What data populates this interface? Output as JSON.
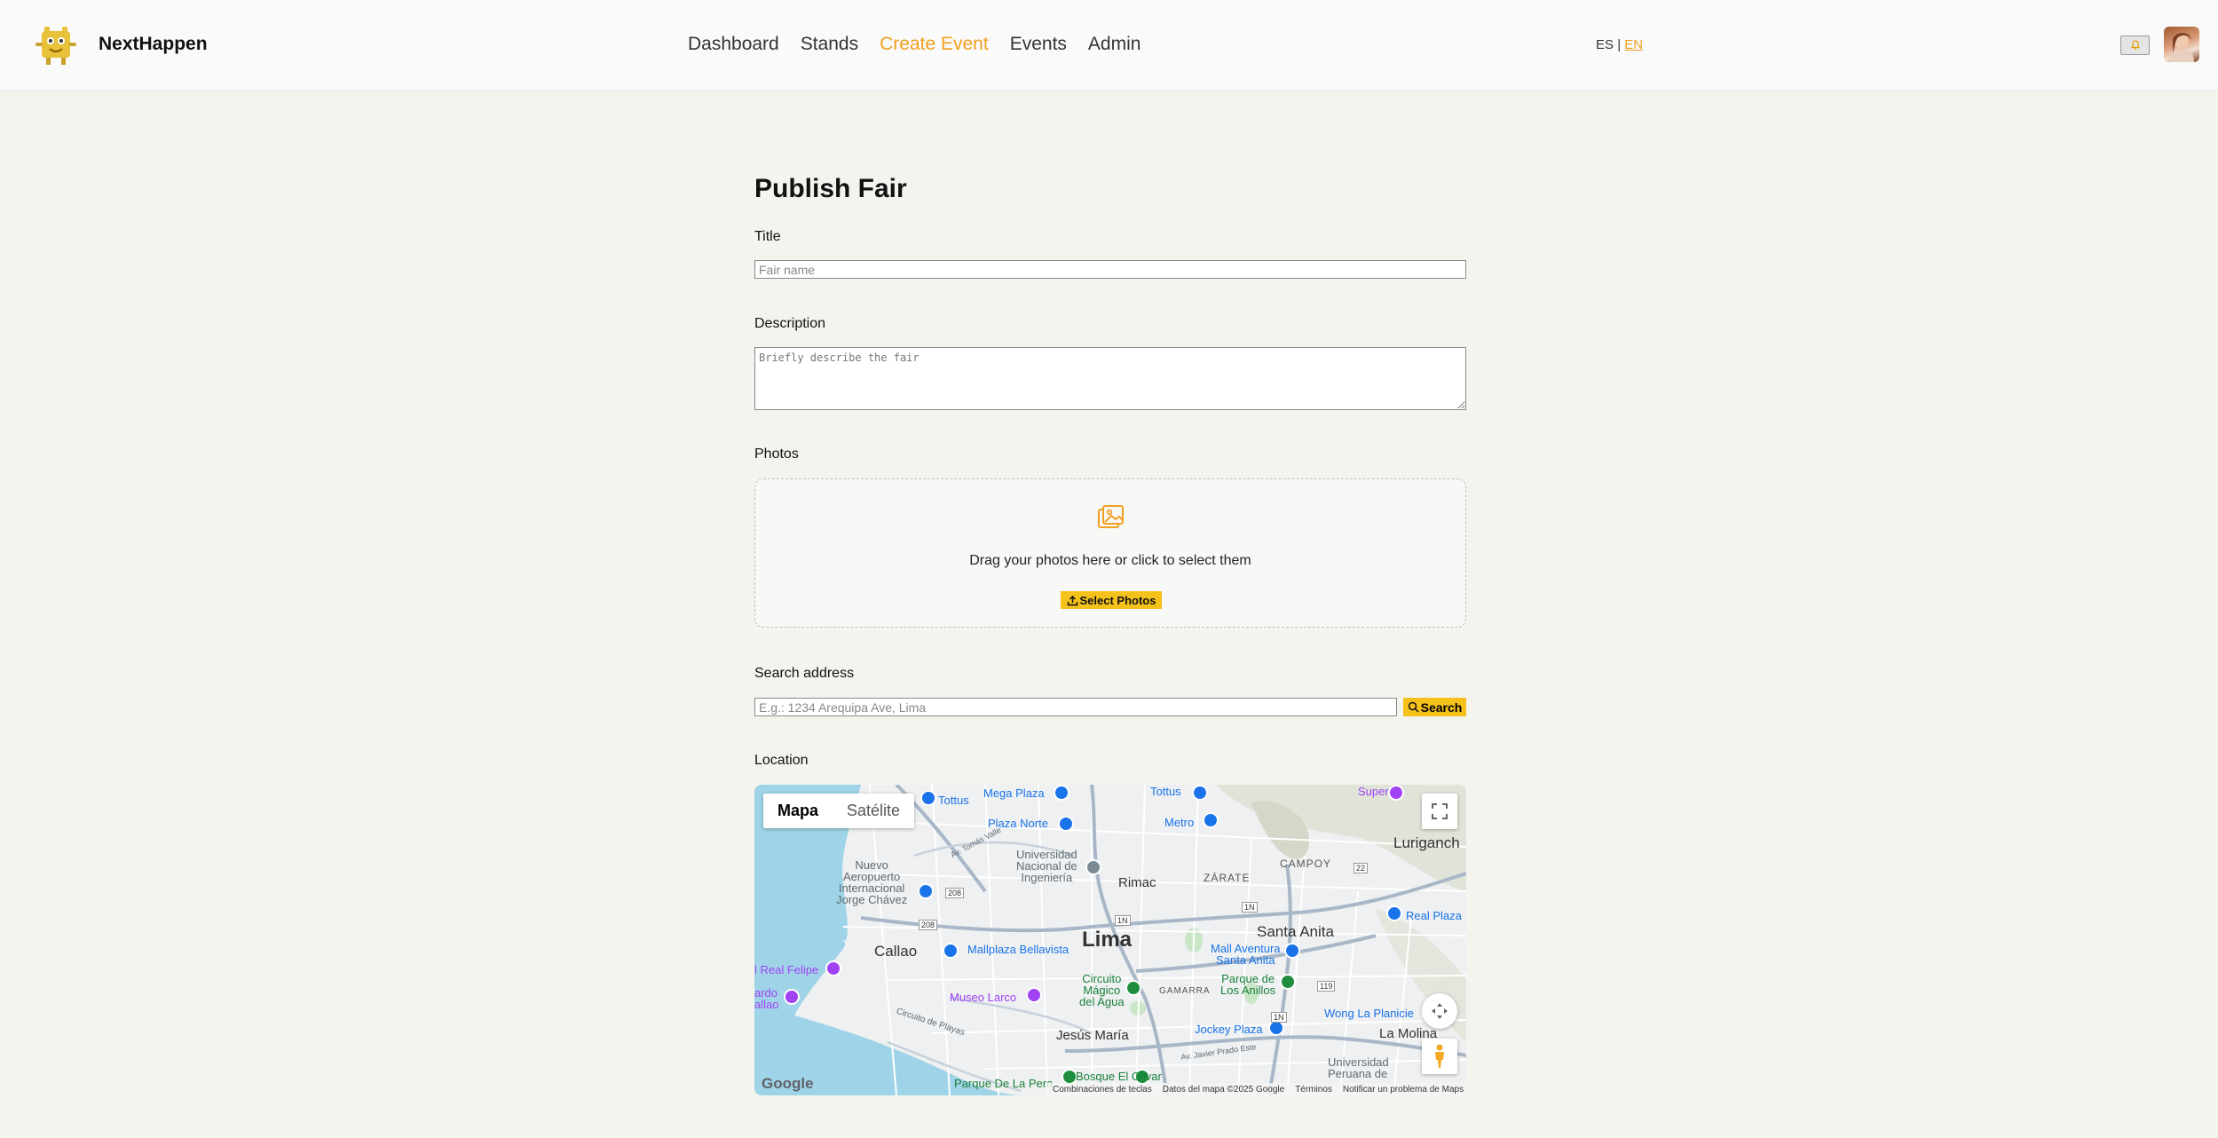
{
  "header": {
    "brand": "NextHappen",
    "nav": [
      "Dashboard",
      "Stands",
      "Create Event",
      "Events",
      "Admin"
    ],
    "active_nav": "Create Event",
    "lang": {
      "es": "ES",
      "sep": "|",
      "en": "EN"
    }
  },
  "form": {
    "title": "Publish Fair",
    "title_label": "Title",
    "title_placeholder": "Fair name",
    "description_label": "Description",
    "description_placeholder": "Briefly describe the fair",
    "photos_label": "Photos",
    "drop_text": "Drag your photos here or click to select them",
    "select_photos": "Select Photos",
    "search_label": "Search address",
    "search_placeholder": "E.g.: 1234 Arequipa Ave, Lima",
    "search_button": "Search",
    "location_label": "Location"
  },
  "map": {
    "type_map": "Mapa",
    "type_satellite": "Satélite",
    "places": {
      "lima": "Lima",
      "callao": "Callao",
      "rimac": "Rimac",
      "santa_anita": "Santa Anita",
      "lurigancho": "Luriganch",
      "la_molina": "La Molina",
      "jesus_maria": "Jesús María",
      "zarate": "ZÁRATE",
      "campoy": "CAMPOY",
      "gamarra": "GAMARRA",
      "tottus1": "Tottus",
      "tottus2": "Tottus",
      "mega_plaza": "Mega Plaza",
      "plaza_norte": "Plaza Norte",
      "metro": "Metro",
      "super": "Super",
      "uni": "Universidad\nNacional de\nIngeniería",
      "airport": "Nuevo\nAeropuerto\nInternacional\nJorge Chávez",
      "mallplaza": "Mallplaza Bellavista",
      "real_plaza": "Real Plaza",
      "real_felipe": "l Real Felipe",
      "ardo": "ardo\nallao",
      "museo_larco": "Museo Larco",
      "circuito": "Circuito\nMágico\ndel Agua",
      "parque_anillos": "Parque de\nLos Anillos",
      "mall_aventura": "Mall Aventura\nSanta Anita",
      "jockey": "Jockey Plaza",
      "wong": "Wong La Planicie",
      "bosque": "Bosque El Olivar",
      "parque_pera": "Parque De La Pera",
      "univ_peruana": "Universidad\nPeruana de",
      "circuito_playas": "Circuito de Playas",
      "av_javier": "Av. Javier Prado Este",
      "av_tomas": "Av. Tomás Valle",
      "r208": "208",
      "r208b": "208",
      "r1n": "1N",
      "r1n2": "1N",
      "r1n3": "1N",
      "r22": "22",
      "r119": "119"
    },
    "attribution": [
      "Combinaciones de teclas",
      "Datos del mapa ©2025 Google",
      "Términos",
      "Notificar un problema de Maps"
    ],
    "google": "Google"
  },
  "icons": [
    "logo-mascot-icon",
    "bell-icon",
    "image-upload-icon",
    "upload-icon",
    "search-icon",
    "fullscreen-icon",
    "pan-control-icon",
    "pegman-icon"
  ],
  "colors": {
    "accent": "#f0a020",
    "button": "#f5c21b",
    "background": "#f4f4ef"
  }
}
